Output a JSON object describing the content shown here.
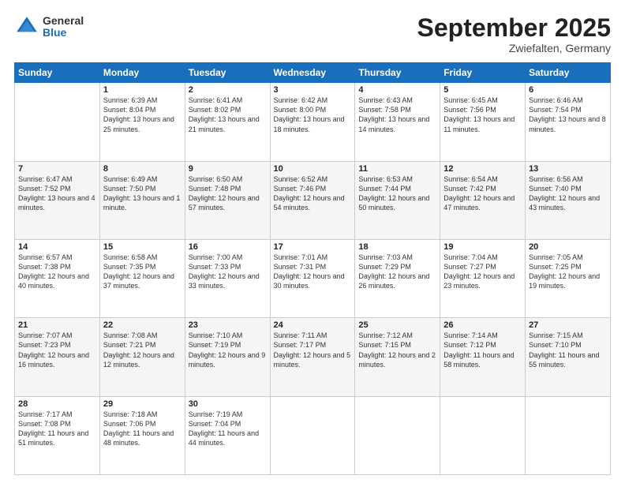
{
  "logo": {
    "general": "General",
    "blue": "Blue"
  },
  "title": "September 2025",
  "location": "Zwiefalten, Germany",
  "days_of_week": [
    "Sunday",
    "Monday",
    "Tuesday",
    "Wednesday",
    "Thursday",
    "Friday",
    "Saturday"
  ],
  "weeks": [
    [
      {
        "day": "",
        "sunrise": "",
        "sunset": "",
        "daylight": ""
      },
      {
        "day": "1",
        "sunrise": "Sunrise: 6:39 AM",
        "sunset": "Sunset: 8:04 PM",
        "daylight": "Daylight: 13 hours and 25 minutes."
      },
      {
        "day": "2",
        "sunrise": "Sunrise: 6:41 AM",
        "sunset": "Sunset: 8:02 PM",
        "daylight": "Daylight: 13 hours and 21 minutes."
      },
      {
        "day": "3",
        "sunrise": "Sunrise: 6:42 AM",
        "sunset": "Sunset: 8:00 PM",
        "daylight": "Daylight: 13 hours and 18 minutes."
      },
      {
        "day": "4",
        "sunrise": "Sunrise: 6:43 AM",
        "sunset": "Sunset: 7:58 PM",
        "daylight": "Daylight: 13 hours and 14 minutes."
      },
      {
        "day": "5",
        "sunrise": "Sunrise: 6:45 AM",
        "sunset": "Sunset: 7:56 PM",
        "daylight": "Daylight: 13 hours and 11 minutes."
      },
      {
        "day": "6",
        "sunrise": "Sunrise: 6:46 AM",
        "sunset": "Sunset: 7:54 PM",
        "daylight": "Daylight: 13 hours and 8 minutes."
      }
    ],
    [
      {
        "day": "7",
        "sunrise": "Sunrise: 6:47 AM",
        "sunset": "Sunset: 7:52 PM",
        "daylight": "Daylight: 13 hours and 4 minutes."
      },
      {
        "day": "8",
        "sunrise": "Sunrise: 6:49 AM",
        "sunset": "Sunset: 7:50 PM",
        "daylight": "Daylight: 13 hours and 1 minute."
      },
      {
        "day": "9",
        "sunrise": "Sunrise: 6:50 AM",
        "sunset": "Sunset: 7:48 PM",
        "daylight": "Daylight: 12 hours and 57 minutes."
      },
      {
        "day": "10",
        "sunrise": "Sunrise: 6:52 AM",
        "sunset": "Sunset: 7:46 PM",
        "daylight": "Daylight: 12 hours and 54 minutes."
      },
      {
        "day": "11",
        "sunrise": "Sunrise: 6:53 AM",
        "sunset": "Sunset: 7:44 PM",
        "daylight": "Daylight: 12 hours and 50 minutes."
      },
      {
        "day": "12",
        "sunrise": "Sunrise: 6:54 AM",
        "sunset": "Sunset: 7:42 PM",
        "daylight": "Daylight: 12 hours and 47 minutes."
      },
      {
        "day": "13",
        "sunrise": "Sunrise: 6:56 AM",
        "sunset": "Sunset: 7:40 PM",
        "daylight": "Daylight: 12 hours and 43 minutes."
      }
    ],
    [
      {
        "day": "14",
        "sunrise": "Sunrise: 6:57 AM",
        "sunset": "Sunset: 7:38 PM",
        "daylight": "Daylight: 12 hours and 40 minutes."
      },
      {
        "day": "15",
        "sunrise": "Sunrise: 6:58 AM",
        "sunset": "Sunset: 7:35 PM",
        "daylight": "Daylight: 12 hours and 37 minutes."
      },
      {
        "day": "16",
        "sunrise": "Sunrise: 7:00 AM",
        "sunset": "Sunset: 7:33 PM",
        "daylight": "Daylight: 12 hours and 33 minutes."
      },
      {
        "day": "17",
        "sunrise": "Sunrise: 7:01 AM",
        "sunset": "Sunset: 7:31 PM",
        "daylight": "Daylight: 12 hours and 30 minutes."
      },
      {
        "day": "18",
        "sunrise": "Sunrise: 7:03 AM",
        "sunset": "Sunset: 7:29 PM",
        "daylight": "Daylight: 12 hours and 26 minutes."
      },
      {
        "day": "19",
        "sunrise": "Sunrise: 7:04 AM",
        "sunset": "Sunset: 7:27 PM",
        "daylight": "Daylight: 12 hours and 23 minutes."
      },
      {
        "day": "20",
        "sunrise": "Sunrise: 7:05 AM",
        "sunset": "Sunset: 7:25 PM",
        "daylight": "Daylight: 12 hours and 19 minutes."
      }
    ],
    [
      {
        "day": "21",
        "sunrise": "Sunrise: 7:07 AM",
        "sunset": "Sunset: 7:23 PM",
        "daylight": "Daylight: 12 hours and 16 minutes."
      },
      {
        "day": "22",
        "sunrise": "Sunrise: 7:08 AM",
        "sunset": "Sunset: 7:21 PM",
        "daylight": "Daylight: 12 hours and 12 minutes."
      },
      {
        "day": "23",
        "sunrise": "Sunrise: 7:10 AM",
        "sunset": "Sunset: 7:19 PM",
        "daylight": "Daylight: 12 hours and 9 minutes."
      },
      {
        "day": "24",
        "sunrise": "Sunrise: 7:11 AM",
        "sunset": "Sunset: 7:17 PM",
        "daylight": "Daylight: 12 hours and 5 minutes."
      },
      {
        "day": "25",
        "sunrise": "Sunrise: 7:12 AM",
        "sunset": "Sunset: 7:15 PM",
        "daylight": "Daylight: 12 hours and 2 minutes."
      },
      {
        "day": "26",
        "sunrise": "Sunrise: 7:14 AM",
        "sunset": "Sunset: 7:12 PM",
        "daylight": "Daylight: 11 hours and 58 minutes."
      },
      {
        "day": "27",
        "sunrise": "Sunrise: 7:15 AM",
        "sunset": "Sunset: 7:10 PM",
        "daylight": "Daylight: 11 hours and 55 minutes."
      }
    ],
    [
      {
        "day": "28",
        "sunrise": "Sunrise: 7:17 AM",
        "sunset": "Sunset: 7:08 PM",
        "daylight": "Daylight: 11 hours and 51 minutes."
      },
      {
        "day": "29",
        "sunrise": "Sunrise: 7:18 AM",
        "sunset": "Sunset: 7:06 PM",
        "daylight": "Daylight: 11 hours and 48 minutes."
      },
      {
        "day": "30",
        "sunrise": "Sunrise: 7:19 AM",
        "sunset": "Sunset: 7:04 PM",
        "daylight": "Daylight: 11 hours and 44 minutes."
      },
      {
        "day": "",
        "sunrise": "",
        "sunset": "",
        "daylight": ""
      },
      {
        "day": "",
        "sunrise": "",
        "sunset": "",
        "daylight": ""
      },
      {
        "day": "",
        "sunrise": "",
        "sunset": "",
        "daylight": ""
      },
      {
        "day": "",
        "sunrise": "",
        "sunset": "",
        "daylight": ""
      }
    ]
  ]
}
